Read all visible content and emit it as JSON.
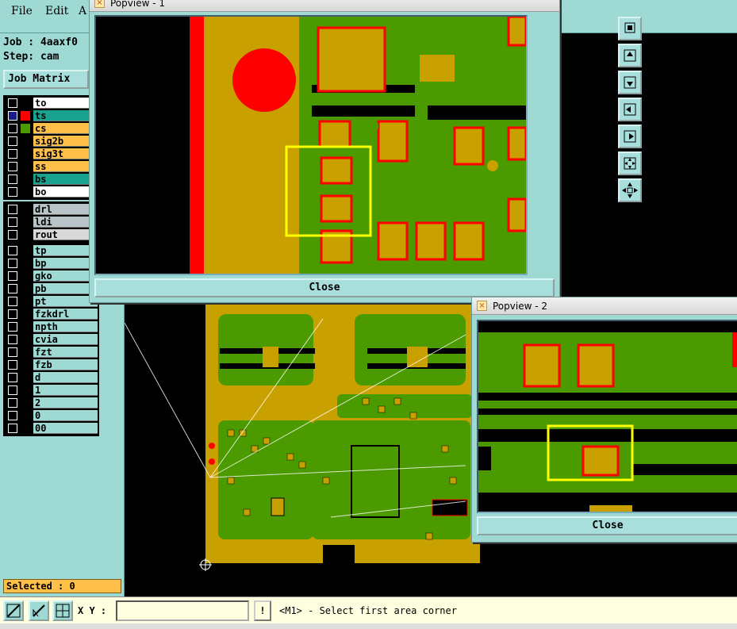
{
  "menubar": {
    "items": [
      {
        "label": "File"
      },
      {
        "label": "Edit"
      },
      {
        "label": "A"
      }
    ]
  },
  "left_panel": {
    "job_line": "Job : 4aaxf0",
    "step_line": "Step: cam",
    "job_matrix_label": "Job Matrix",
    "layers_group1": [
      {
        "name": "to",
        "color": "#ffffff",
        "checked": false
      },
      {
        "name": "ts",
        "color": "#19a38e",
        "checked": true
      },
      {
        "name": "cs",
        "color": "#ffc04a",
        "checked": false
      },
      {
        "name": "sig2b",
        "color": "#ffc04a",
        "checked": false
      },
      {
        "name": "sig3t",
        "color": "#ffc04a",
        "checked": false
      },
      {
        "name": "ss",
        "color": "#ffc04a",
        "checked": false
      },
      {
        "name": "bs",
        "color": "#19a38e",
        "checked": false
      },
      {
        "name": "bo",
        "color": "#ffffff",
        "checked": false
      }
    ],
    "layers_group2": [
      {
        "name": "drl",
        "color": "#b8c4c8"
      },
      {
        "name": "ldi",
        "color": "#b8c4c8"
      },
      {
        "name": "rout",
        "color": "#d8d8d8"
      }
    ],
    "layers_group3": [
      {
        "name": "tp"
      },
      {
        "name": "bp"
      },
      {
        "name": "gko"
      },
      {
        "name": "pb"
      },
      {
        "name": "pt"
      },
      {
        "name": "fzkdrl"
      },
      {
        "name": "npth"
      },
      {
        "name": "cvia"
      },
      {
        "name": "fzt"
      },
      {
        "name": "fzb"
      },
      {
        "name": "d"
      },
      {
        "name": "1"
      },
      {
        "name": "2"
      },
      {
        "name": "0"
      },
      {
        "name": "00"
      }
    ],
    "selected_label": "Selected : 0"
  },
  "bottombar": {
    "xy_label": "X Y :",
    "xy_value": "",
    "excl_label": "!",
    "status": "<M1> - Select first area corner"
  },
  "popview1": {
    "title": "Popview - 1",
    "close_label": "Close",
    "tool_icons": [
      "zoom-fit-icon",
      "pan-up-icon",
      "pan-down-icon",
      "pan-left-icon",
      "pan-right-icon",
      "zoom-in-icon",
      "zoom-out-icon"
    ]
  },
  "popview2": {
    "title": "Popview - 2",
    "close_label": "Close"
  },
  "colors": {
    "panel": "#9fd9d4",
    "copper": "#c8a000",
    "board": "#4a9a00",
    "pad_outline": "#ff0000",
    "highlight": "#ffff00"
  }
}
